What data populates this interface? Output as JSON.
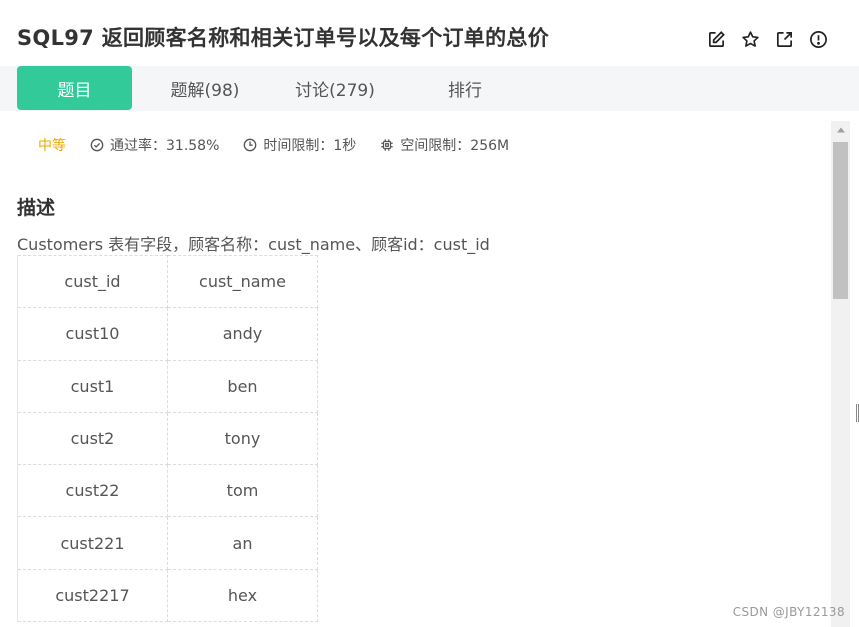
{
  "header": {
    "title": "SQL97  返回顾客名称和相关订单号以及每个订单的总价",
    "icons": [
      "edit-icon",
      "star-icon",
      "external-link-icon",
      "report-icon"
    ]
  },
  "tabs": [
    {
      "label": "题目",
      "active": true
    },
    {
      "label": "题解(98)",
      "active": false
    },
    {
      "label": "讨论(279)",
      "active": false
    },
    {
      "label": "排行",
      "active": false
    }
  ],
  "meta": {
    "difficulty": "中等",
    "pass_rate": "通过率：31.58%",
    "time_limit": "时间限制：1秒",
    "space_limit": "空间限制：256M"
  },
  "description": {
    "heading": "描述",
    "intro": "Customers 表有字段，顾客名称：cust_name、顾客id：cust_id"
  },
  "customers_table": {
    "headers": [
      "cust_id",
      "cust_name"
    ],
    "rows": [
      [
        "cust10",
        "andy"
      ],
      [
        "cust1",
        "ben"
      ],
      [
        "cust2",
        "tony"
      ],
      [
        "cust22",
        "tom"
      ],
      [
        "cust221",
        "an"
      ],
      [
        "cust2217",
        "hex"
      ]
    ]
  },
  "watermark": "CSDN @JBY12138",
  "colors": {
    "accent": "#32ca99",
    "difficulty": "#f0a800"
  }
}
